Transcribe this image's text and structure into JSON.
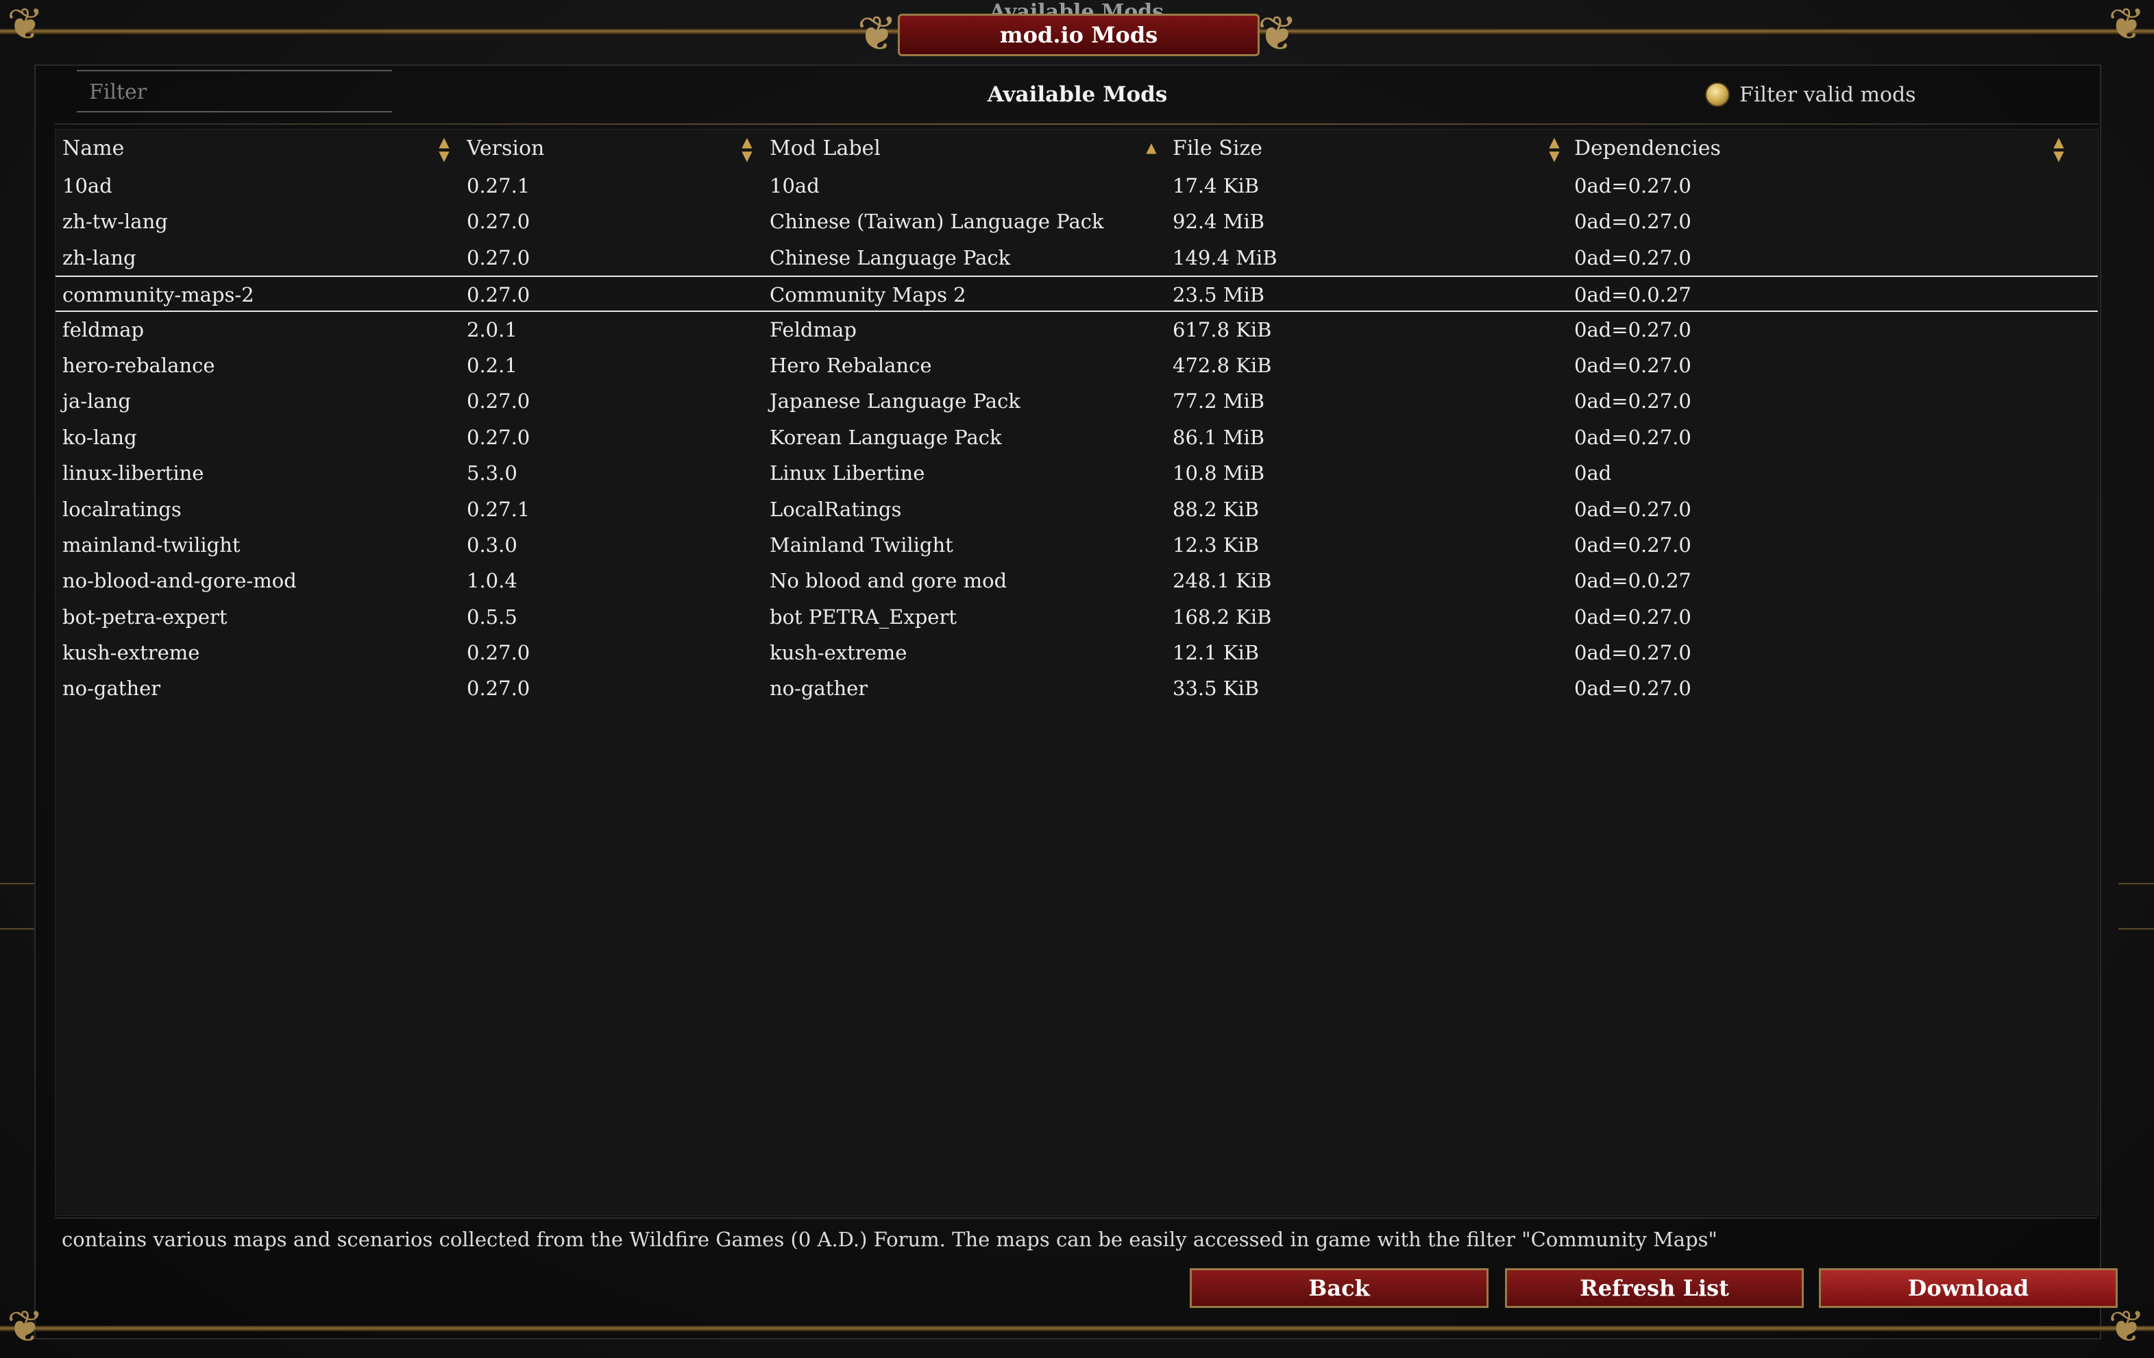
{
  "window": {
    "ghost_title": "Available Mods",
    "title": "mod.io Mods"
  },
  "filter": {
    "placeholder": "Filter"
  },
  "list_title": "Available Mods",
  "valid_toggle": {
    "label": "Filter valid mods",
    "checked": true
  },
  "table": {
    "columns": [
      {
        "label": "Name",
        "sort": "both"
      },
      {
        "label": "Version",
        "sort": "both"
      },
      {
        "label": "Mod Label",
        "sort": "asc"
      },
      {
        "label": "File Size",
        "sort": "both"
      },
      {
        "label": "Dependencies",
        "sort": "both"
      }
    ],
    "rows": [
      {
        "name": "10ad",
        "version": "0.27.1",
        "label": "10ad",
        "size": "17.4 KiB",
        "deps": "0ad=0.27.0"
      },
      {
        "name": "zh-tw-lang",
        "version": "0.27.0",
        "label": "Chinese (Taiwan) Language Pack",
        "size": "92.4 MiB",
        "deps": "0ad=0.27.0"
      },
      {
        "name": "zh-lang",
        "version": "0.27.0",
        "label": "Chinese Language Pack",
        "size": "149.4 MiB",
        "deps": "0ad=0.27.0"
      },
      {
        "name": "community-maps-2",
        "version": "0.27.0",
        "label": "Community Maps 2",
        "size": "23.5 MiB",
        "deps": "0ad=0.0.27",
        "selected": true
      },
      {
        "name": "feldmap",
        "version": "2.0.1",
        "label": "Feldmap",
        "size": "617.8 KiB",
        "deps": "0ad=0.27.0"
      },
      {
        "name": "hero-rebalance",
        "version": "0.2.1",
        "label": "Hero Rebalance",
        "size": "472.8 KiB",
        "deps": "0ad=0.27.0"
      },
      {
        "name": "ja-lang",
        "version": "0.27.0",
        "label": "Japanese Language Pack",
        "size": "77.2 MiB",
        "deps": "0ad=0.27.0"
      },
      {
        "name": "ko-lang",
        "version": "0.27.0",
        "label": "Korean Language Pack",
        "size": "86.1 MiB",
        "deps": "0ad=0.27.0"
      },
      {
        "name": "linux-libertine",
        "version": "5.3.0",
        "label": "Linux Libertine",
        "size": "10.8 MiB",
        "deps": "0ad"
      },
      {
        "name": "localratings",
        "version": "0.27.1",
        "label": "LocalRatings",
        "size": "88.2 KiB",
        "deps": "0ad=0.27.0"
      },
      {
        "name": "mainland-twilight",
        "version": "0.3.0",
        "label": "Mainland Twilight",
        "size": "12.3 KiB",
        "deps": "0ad=0.27.0"
      },
      {
        "name": "no-blood-and-gore-mod",
        "version": "1.0.4",
        "label": "No blood and gore mod",
        "size": "248.1 KiB",
        "deps": "0ad=0.0.27"
      },
      {
        "name": "bot-petra-expert",
        "version": "0.5.5",
        "label": "bot PETRA_Expert",
        "size": "168.2 KiB",
        "deps": "0ad=0.27.0"
      },
      {
        "name": "kush-extreme",
        "version": "0.27.0",
        "label": "kush-extreme",
        "size": "12.1 KiB",
        "deps": "0ad=0.27.0"
      },
      {
        "name": "no-gather",
        "version": "0.27.0",
        "label": "no-gather",
        "size": "33.5 KiB",
        "deps": "0ad=0.27.0"
      }
    ]
  },
  "description": "contains various maps and scenarios collected from the Wildfire Games (0 A.D.) Forum. The maps can be easily accessed in game with the filter \"Community Maps\"",
  "buttons": {
    "back": "Back",
    "refresh": "Refresh List",
    "download": "Download"
  },
  "icons": {
    "sort_both": "sort-updown-icon",
    "sort_asc": "sort-asc-icon",
    "ornament": "fleur-ornament-icon"
  },
  "colors": {
    "accent_gold": "#c9a24e",
    "button_red": "#7a1010",
    "title_red": "#6a0e0e"
  }
}
